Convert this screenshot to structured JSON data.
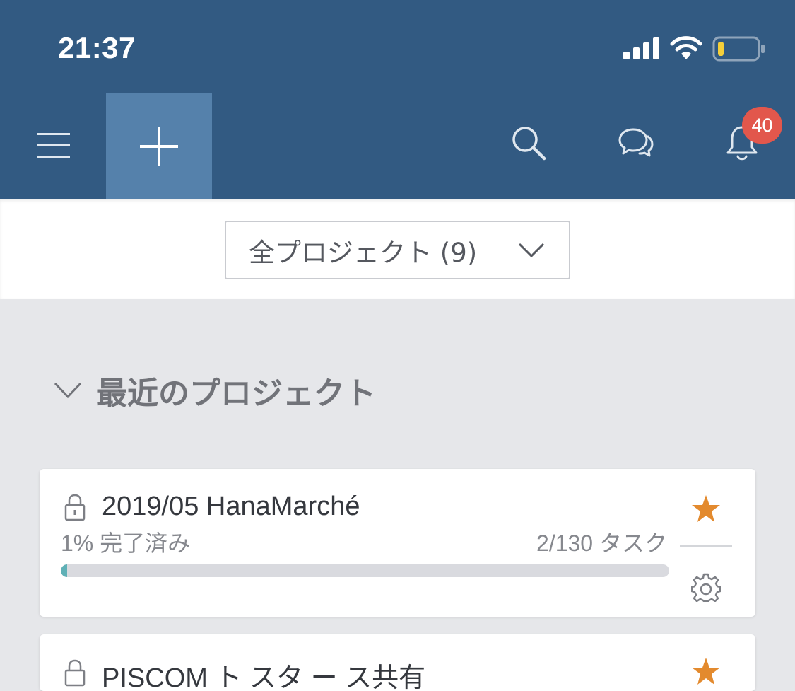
{
  "status_bar": {
    "time": "21:37"
  },
  "toolbar": {
    "menu_icon": "hamburger-menu-icon",
    "add_icon": "plus-icon",
    "search_icon": "search-icon",
    "chat_icon": "chat-bubbles-icon",
    "notification_icon": "bell-icon",
    "notification_count": "40"
  },
  "filter": {
    "selected": "全プロジェクト (9)"
  },
  "section": {
    "title": "最近のプロジェクト"
  },
  "projects": [
    {
      "title": "2019/05 HanaMarché",
      "progress_text": "1% 完了済み",
      "progress_fraction": 0.01,
      "task_count": "2/130 タスク",
      "starred": true
    },
    {
      "title": "PISCOM ト スタ ー ス共有",
      "starred": true
    }
  ],
  "colors": {
    "header_bg": "#325a82",
    "add_button_bg": "#5581ab",
    "badge_bg": "#e2574c",
    "star": "#e38a2e",
    "progress_fill": "#5fb0b6",
    "page_bg": "#e6e7ea"
  }
}
